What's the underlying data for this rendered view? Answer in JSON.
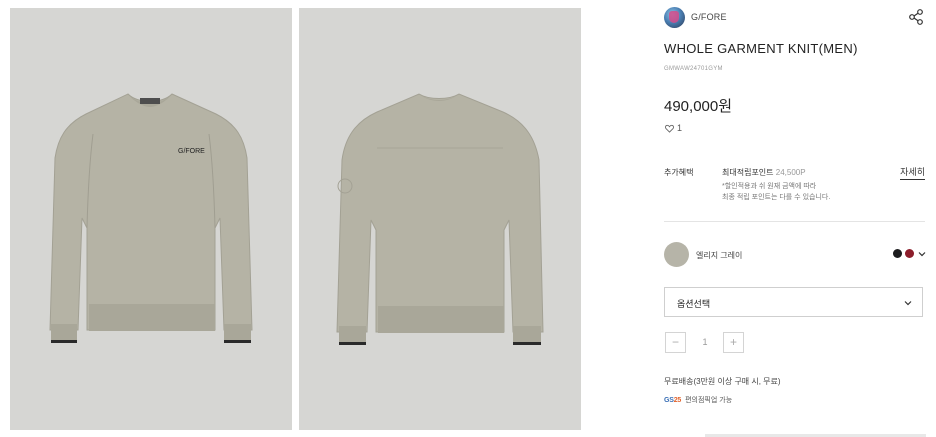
{
  "brand": {
    "name": "G/FORE",
    "logo_icon": "brand-avatar-icon"
  },
  "share_icon": "share-icon",
  "product": {
    "title": "WHOLE GARMENT KNIT(MEN)",
    "sku": "GMWAW24701GYM",
    "price": "490,000원",
    "likes": "1",
    "chest_logo_text": "G/FORE"
  },
  "benefits": {
    "label": "추가혜택",
    "max_points_label": "최대적립포인트",
    "max_points_value": "24,500P",
    "note_line1": "*할인적용과 쉬 원재 금액에 따라",
    "note_line2": "최종 적립 포인트는 다를 수 있습니다.",
    "detail_link": "자세히"
  },
  "color": {
    "selected_name": "엘리지 그레이",
    "selected_hex": "#b6b4a8",
    "options": [
      {
        "name": "black",
        "hex": "#1c1c1e"
      },
      {
        "name": "red",
        "hex": "#8c1d2b"
      }
    ]
  },
  "option_select": {
    "label": "옵션선택"
  },
  "quantity": {
    "minus": "−",
    "value": "1",
    "plus": "+"
  },
  "shipping": {
    "text": "무료배송(3만원 이상 구매 시, 무료)"
  },
  "pickup": {
    "logo_text_a": "GS",
    "logo_text_b": "25",
    "text": "편의점픽업 가능"
  }
}
